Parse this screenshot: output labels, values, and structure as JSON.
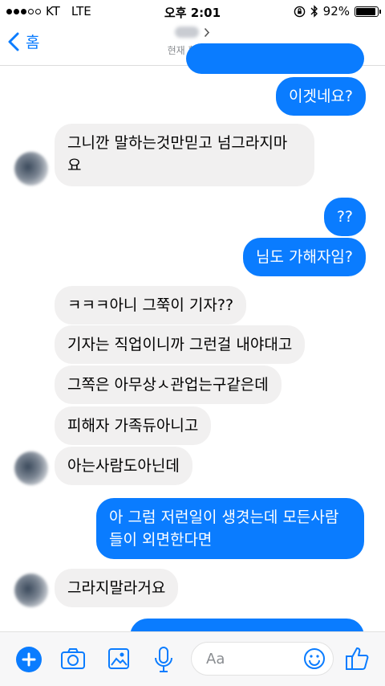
{
  "status_bar": {
    "carrier": "KT",
    "network": "LTE",
    "time": "오후 2:01",
    "battery": "92%",
    "battery_level": 0.92
  },
  "nav": {
    "back_label": "홈",
    "contact_status": "현재 활동 중"
  },
  "messages": [
    {
      "dir": "out",
      "text": "이겟네요?"
    },
    {
      "dir": "in",
      "line1": "그니깐 말하는것만믿고 넘그라지마",
      "line2": "요"
    },
    {
      "dir": "out",
      "text": "??"
    },
    {
      "dir": "out",
      "text": "님도 가해자임?"
    },
    {
      "dir": "in",
      "text": "ㅋㅋㅋ아니 그쭉이 기자??"
    },
    {
      "dir": "in",
      "text": "기자는 직업이니까 그런걸 내야대고"
    },
    {
      "dir": "in",
      "text": "그쪽은 아무상ㅅ관업는구같은데"
    },
    {
      "dir": "in",
      "text": "피해자 가족듀아니고"
    },
    {
      "dir": "in",
      "text": "아는사람도아닌데"
    },
    {
      "dir": "out",
      "line1": "아 그럼 저런일이 생겻는데 모든사람",
      "line2": "들이 외면한다면"
    },
    {
      "dir": "in",
      "text": "그라지말라거요"
    }
  ],
  "composer": {
    "placeholder": "Aa"
  },
  "colors": {
    "accent": "#0a7cff",
    "incoming_bubble": "#f1f0f0"
  },
  "icons": [
    "plus-icon",
    "camera-icon",
    "image-icon",
    "microphone-icon",
    "emoji-icon",
    "thumbs-up-icon"
  ]
}
